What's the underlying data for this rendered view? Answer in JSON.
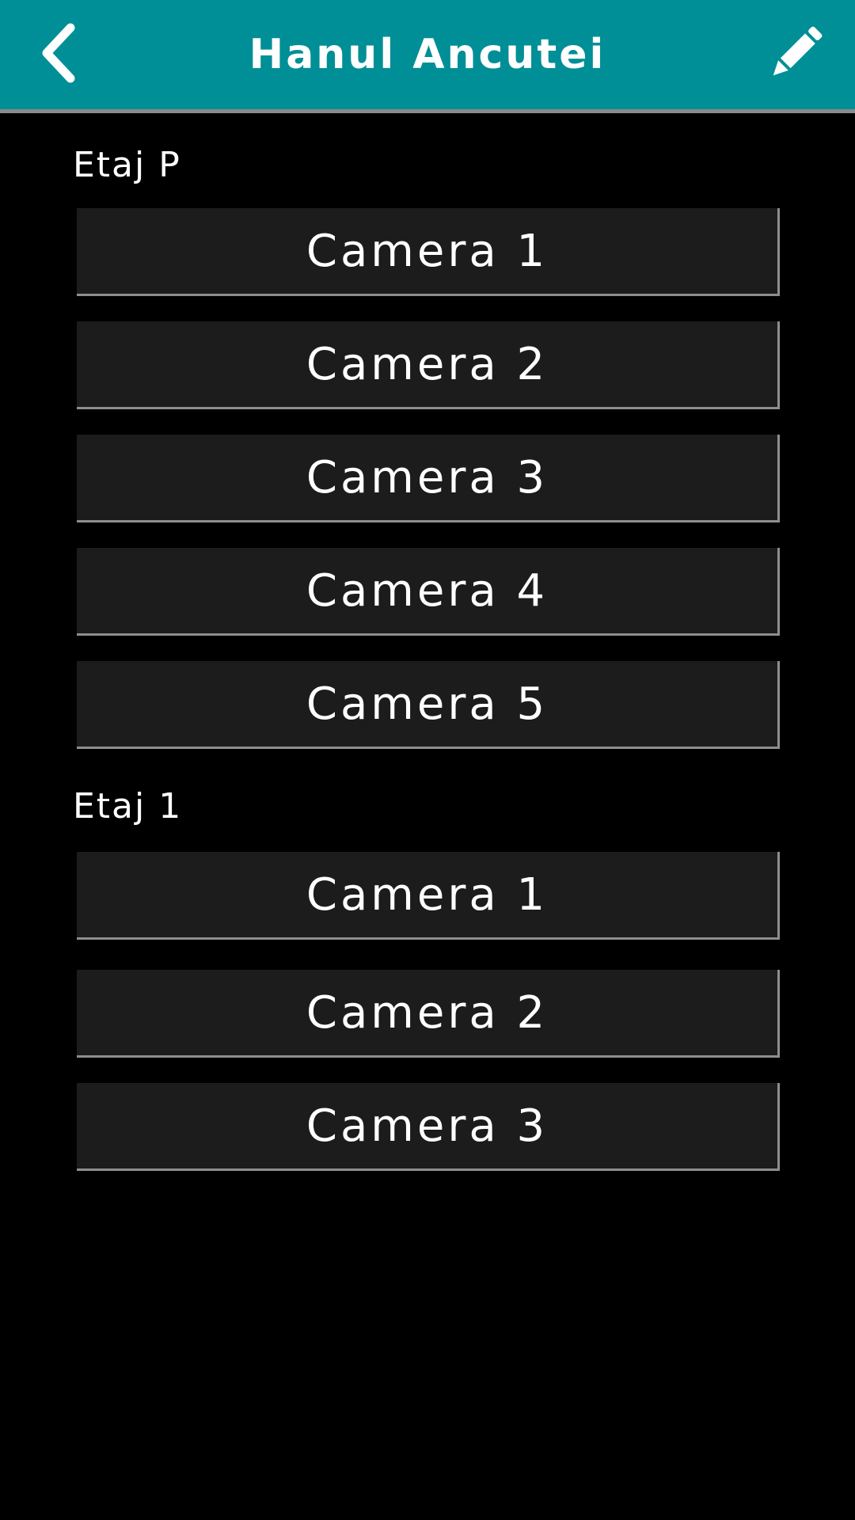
{
  "header": {
    "title": "Hanul Ancutei",
    "back_icon": "chevron-left-icon",
    "edit_icon": "pencil-icon",
    "background_color": "#008f96"
  },
  "floors": [
    {
      "label": "Etaj P",
      "rooms": [
        {
          "label": "Camera 1"
        },
        {
          "label": "Camera 2"
        },
        {
          "label": "Camera 3"
        },
        {
          "label": "Camera 4"
        },
        {
          "label": "Camera 5"
        }
      ]
    },
    {
      "label": "Etaj 1",
      "rooms": [
        {
          "label": "Camera 1"
        },
        {
          "label": "Camera 2"
        },
        {
          "label": "Camera 3"
        }
      ]
    }
  ]
}
